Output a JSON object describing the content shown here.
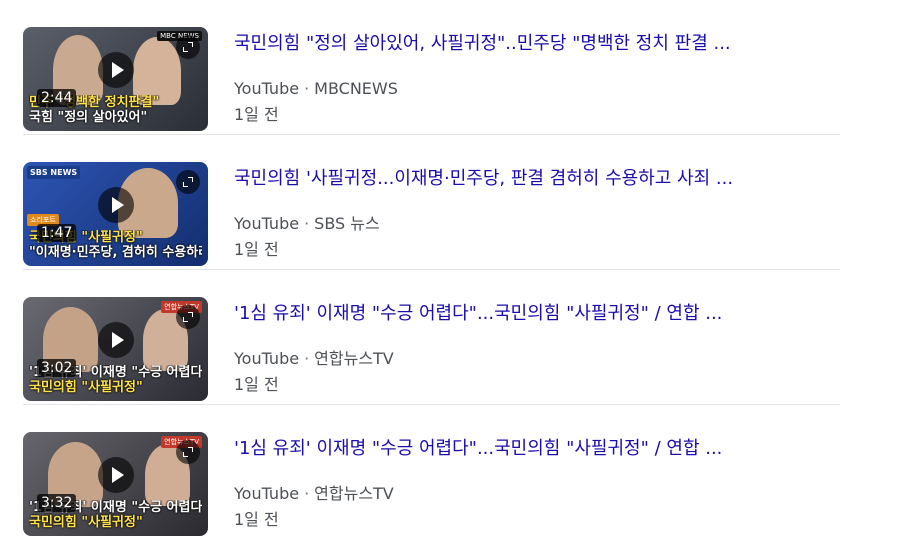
{
  "results": [
    {
      "title": "국민의힘 \"정의 살아있어, 사필귀정\"..민주당 \"명백한 정치 판결 ...",
      "source": "YouTube",
      "channel": "MBCNEWS",
      "time": "1일 전",
      "duration": "2:44",
      "thumb_logo": "MBC NEWS",
      "thumb_caption_1": "민주 \"명백한 정치판결\"",
      "thumb_caption_2": "국힘 \"정의 살아있어\"",
      "thumb_bg": "#3a3f4a"
    },
    {
      "title": "국민의힘 '사필귀정...이재명·민주당, 판결 겸허히 수용하고 사죄 ...",
      "source": "YouTube",
      "channel": "SBS 뉴스",
      "time": "1일 전",
      "duration": "1:47",
      "thumb_logo": "SBS NEWS",
      "thumb_tag": "쇼리포트",
      "thumb_caption_1": "국민의힘 \"사필귀정\"",
      "thumb_caption_2": "\"이재명·민주당, 겸허히 수용하라\"",
      "thumb_bg": "#1f3f8f"
    },
    {
      "title": "'1심 유죄' 이재명 \"수긍 어렵다\"...국민의힘 \"사필귀정\" / 연합 ...",
      "source": "YouTube",
      "channel": "연합뉴스TV",
      "time": "1일 전",
      "duration": "3:02",
      "thumb_tag": "연합뉴스TV",
      "thumb_caption_1": "'1심 유죄' 이재명 \"수긍 어렵다\"",
      "thumb_caption_2": "국민의힘 \"사필귀정\"",
      "thumb_bg": "#4a4a52"
    },
    {
      "title": "'1심 유죄' 이재명 \"수긍 어렵다\"...국민의힘 \"사필귀정\" / 연합 ...",
      "source": "YouTube",
      "channel": "연합뉴스TV",
      "time": "1일 전",
      "duration": "3:32",
      "thumb_tag": "연합뉴스TV",
      "thumb_caption_1": "'1심 유죄' 이재명 \"수긍 어렵다\"",
      "thumb_caption_2": "국민의힘 \"사필귀정\"",
      "thumb_bg": "#47464e"
    }
  ],
  "icons": {
    "play": "play-icon",
    "expand": "expand-icon"
  },
  "colors": {
    "title_link": "#1a0dab",
    "meta_text": "#4d5156",
    "separator": "#e4e4e4"
  }
}
